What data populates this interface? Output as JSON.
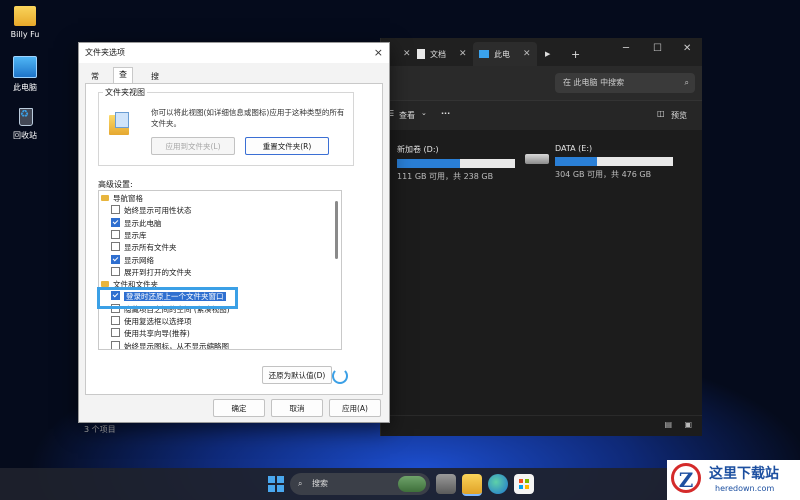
{
  "desktop": {
    "icons": [
      {
        "label": "Billy Fu",
        "icon": "folder-icon"
      },
      {
        "label": "此电脑",
        "icon": "this-pc-icon"
      },
      {
        "label": "回收站",
        "icon": "recycle-bin-icon"
      }
    ]
  },
  "explorer": {
    "tabs": [
      {
        "label": "文档",
        "icon": "document-icon"
      },
      {
        "label": "此电",
        "icon": "this-pc-icon"
      }
    ],
    "new_tab": "+",
    "search_placeholder": "在 此电脑 中搜索",
    "toolbar": {
      "view_label": "查看",
      "more_label": "···",
      "preview_label": "预览"
    },
    "drives": [
      {
        "name": "新加卷 (D:)",
        "free_text": "111 GB 可用，共 238 GB",
        "used_fraction": 0.53
      },
      {
        "name": "DATA (E:)",
        "free_text": "304 GB 可用，共 476 GB",
        "used_fraction": 0.36
      }
    ],
    "status": "3 个项目"
  },
  "dialog": {
    "title": "文件夹选项",
    "close": "×",
    "tabs": [
      "常规",
      "查看",
      "搜索"
    ],
    "active_tab": "查看",
    "folder_view": {
      "label": "文件夹视图",
      "description": "你可以将此视图(如详细信息或图标)应用于这种类型的所有文件夹。",
      "apply_button": "应用到文件夹(L)",
      "reset_button": "重置文件夹(R)"
    },
    "advanced_label": "高级设置:",
    "advanced_items": [
      {
        "type": "folder",
        "label": "导航窗格"
      },
      {
        "type": "check",
        "label": "始终显示可用性状态",
        "checked": false
      },
      {
        "type": "check",
        "label": "显示此电脑",
        "checked": true
      },
      {
        "type": "check",
        "label": "显示库",
        "checked": false
      },
      {
        "type": "check",
        "label": "显示所有文件夹",
        "checked": false
      },
      {
        "type": "check",
        "label": "显示网络",
        "checked": true
      },
      {
        "type": "check",
        "label": "展开到打开的文件夹",
        "checked": false
      },
      {
        "type": "folder",
        "label": "文件和文件夹"
      },
      {
        "type": "check",
        "label": "登录时还原上一个文件夹窗口",
        "checked": true
      },
      {
        "type": "check",
        "label": "隐藏项目之间的空间 (紧凑视图)",
        "checked": false
      },
      {
        "type": "check",
        "label": "使用复选框以选择项",
        "checked": false
      },
      {
        "type": "check",
        "label": "使用共享向导(推荐)",
        "checked": false
      },
      {
        "type": "check",
        "label": "始终显示图标，从不显示缩略图",
        "checked": false
      }
    ],
    "restore_defaults": "还原为默认值(D)",
    "ok": "确定",
    "cancel": "取消",
    "apply": "应用(A)"
  },
  "taskbar": {
    "search_label": "搜索"
  },
  "watermark": {
    "title": "这里下载站",
    "url": "heredown.com",
    "logo_letter": "Z"
  }
}
